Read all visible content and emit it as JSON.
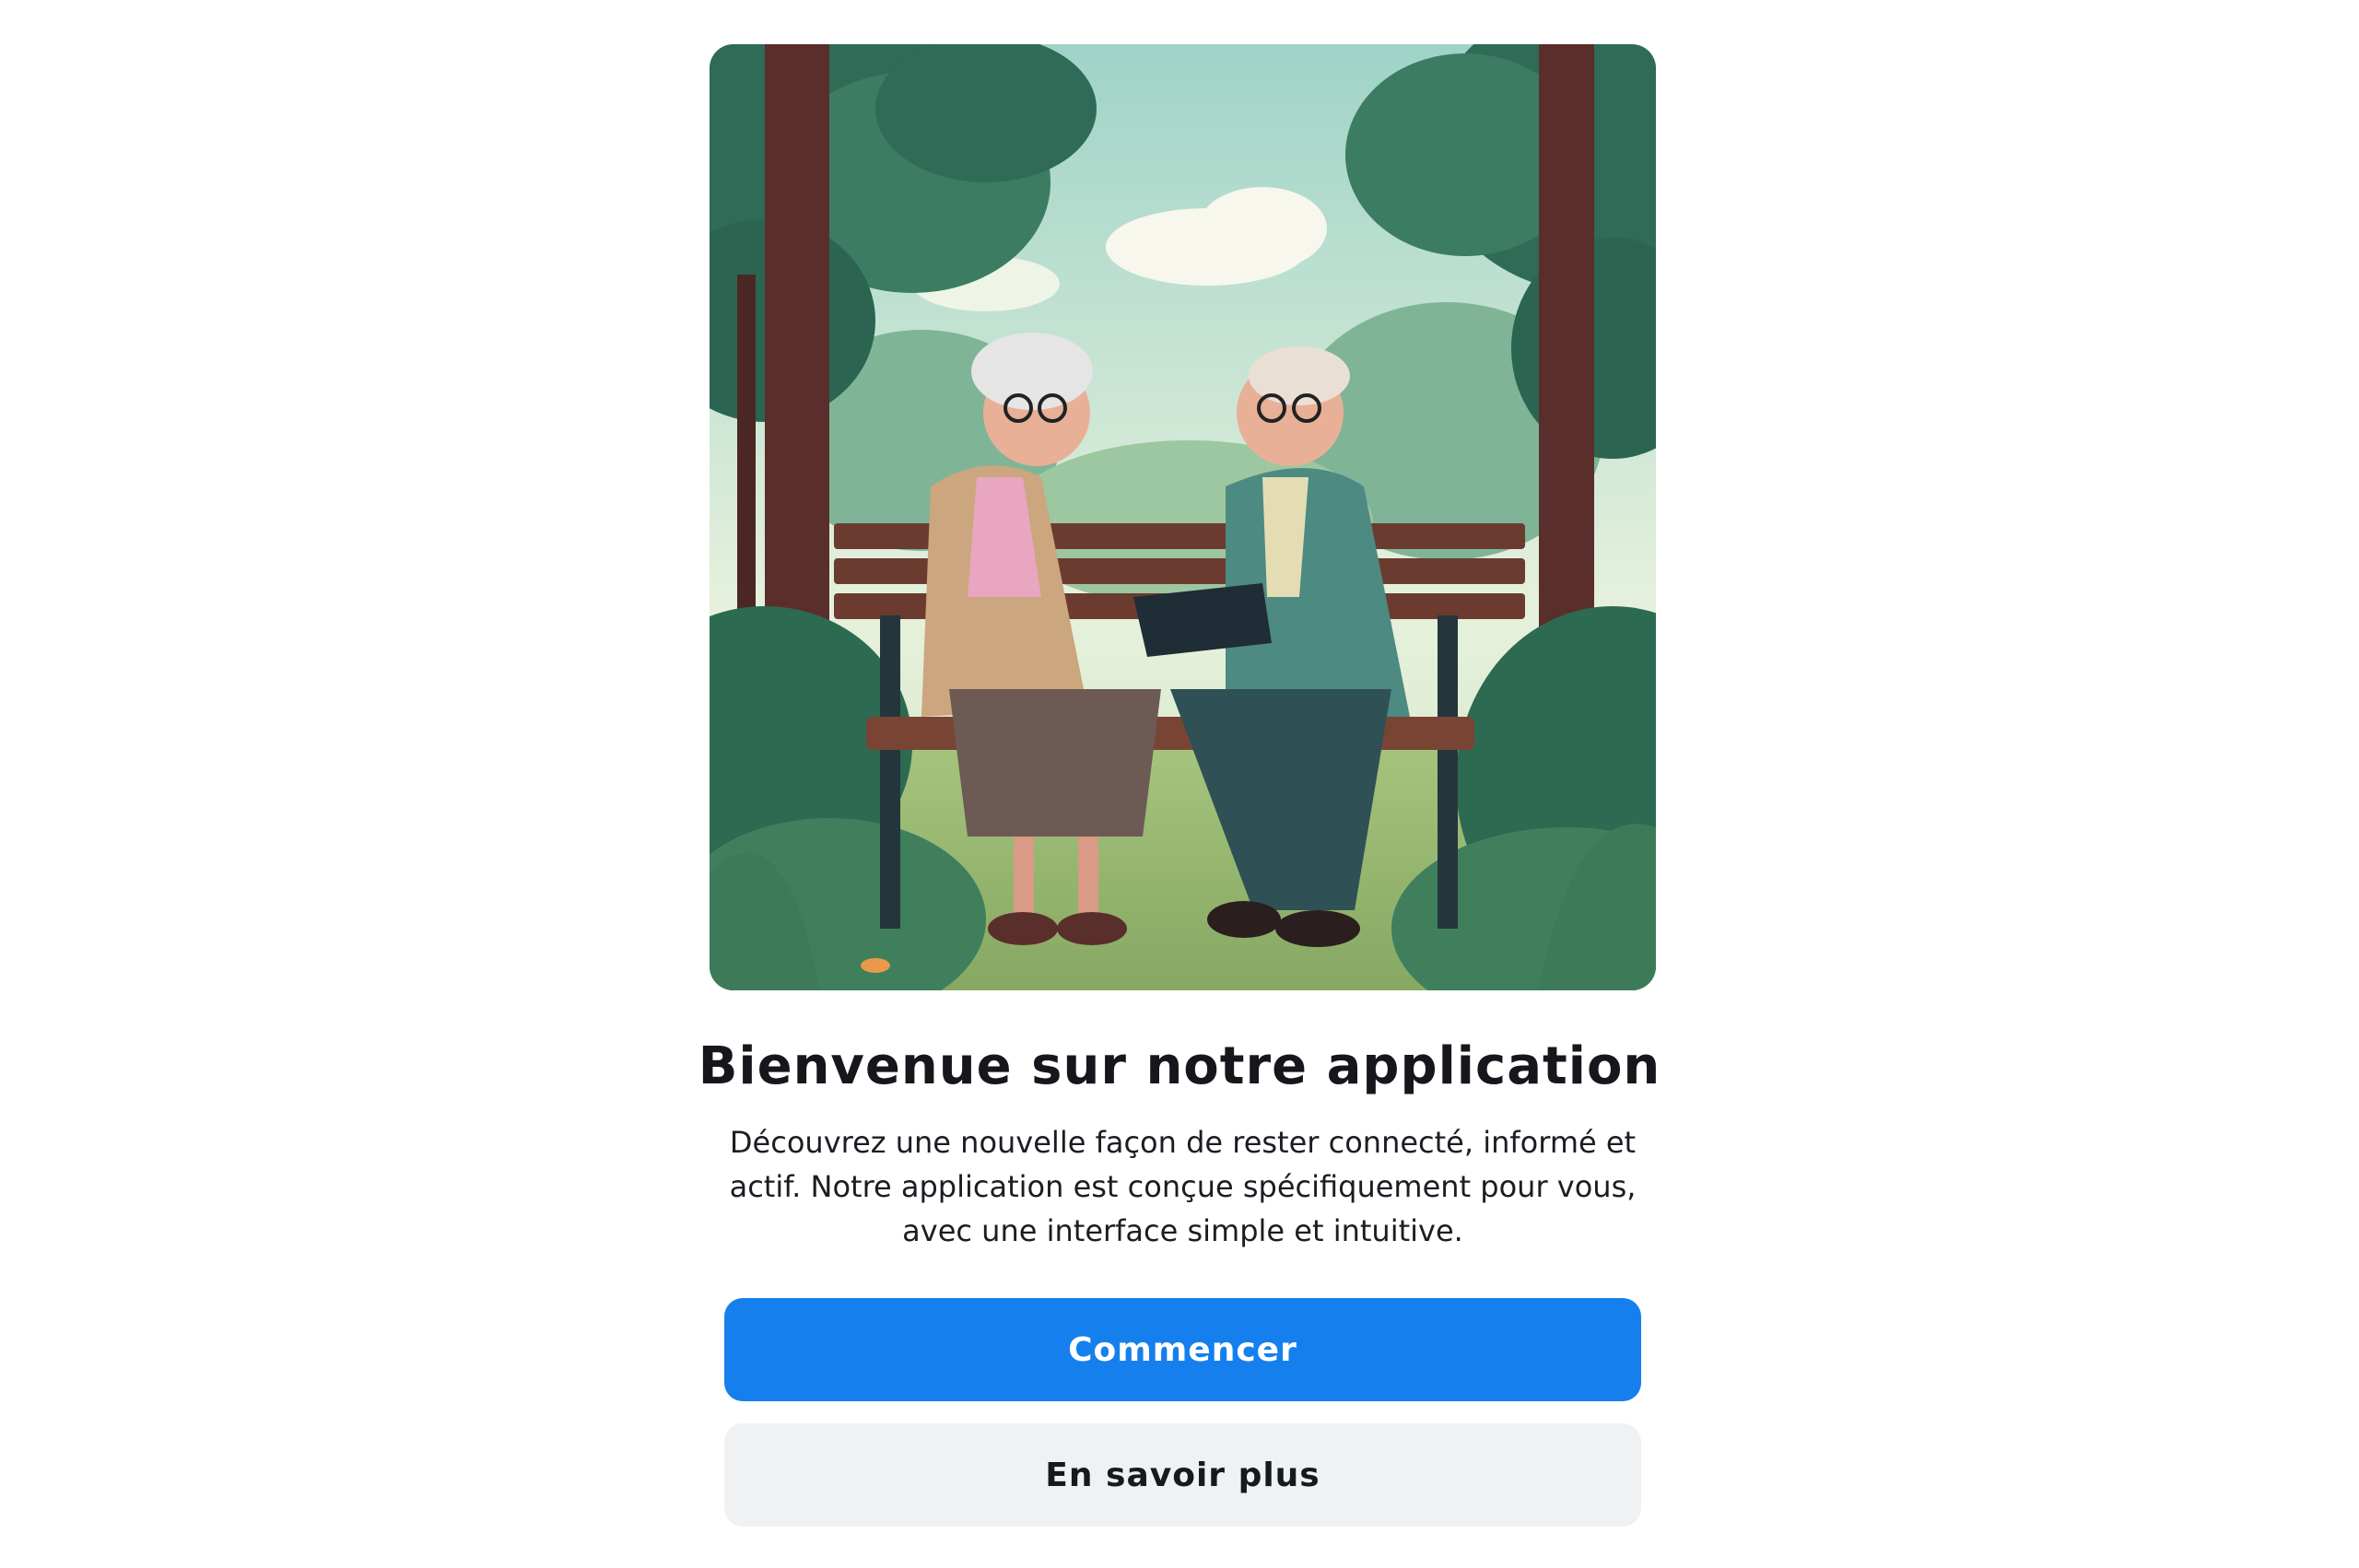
{
  "welcome": {
    "title": "Bienvenue sur notre application",
    "description": "Découvrez une nouvelle façon de rester connecté, informé et actif. Notre application est conçue spécifiquement pour vous, avec une interface simple et intuitive.",
    "primary_label": "Commencer",
    "secondary_label": "En savoir plus"
  },
  "colors": {
    "primary": "#1580ed",
    "secondary_bg": "#f0f1f3",
    "title_text": "#15171c"
  }
}
